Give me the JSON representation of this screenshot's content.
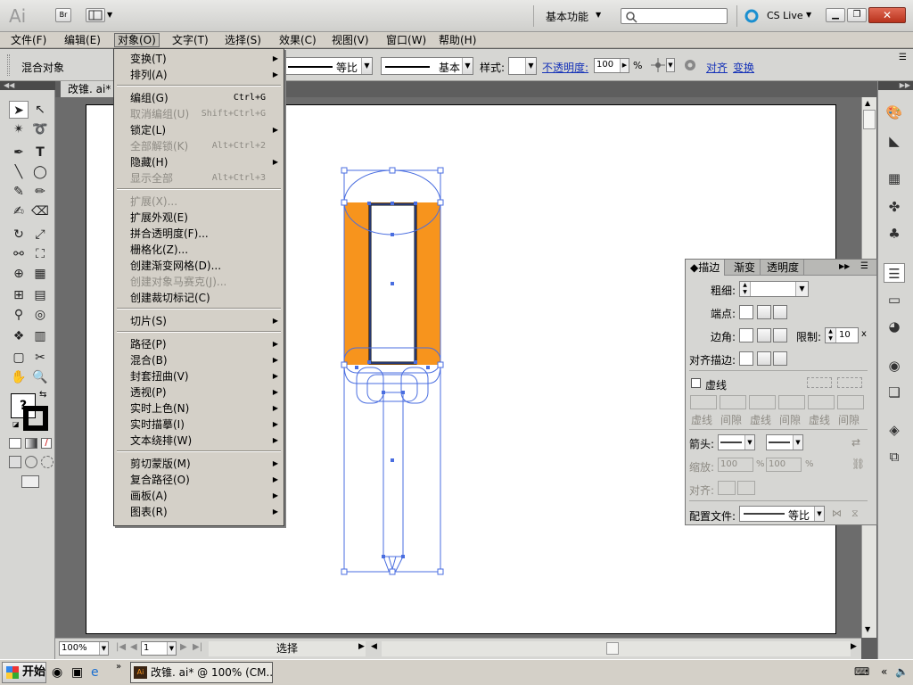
{
  "app": {
    "logo": "Ai",
    "bridge_label": "Br",
    "workspace": "基本功能",
    "search_placeholder": "",
    "cs_live": "CS Live"
  },
  "menubar": [
    {
      "label": "文件(F)"
    },
    {
      "label": "编辑(E)"
    },
    {
      "label": "对象(O)"
    },
    {
      "label": "文字(T)"
    },
    {
      "label": "选择(S)"
    },
    {
      "label": "效果(C)"
    },
    {
      "label": "视图(V)"
    },
    {
      "label": "窗口(W)"
    },
    {
      "label": "帮助(H)"
    }
  ],
  "control_bar": {
    "selection_label": "混合对象",
    "profile_label": "等比",
    "brush_label": "基本",
    "style_label": "样式:",
    "opacity_label": "不透明度:",
    "opacity_value": "100",
    "percent": "%",
    "align_link": "对齐",
    "transform_link": "变换"
  },
  "document_tab": "改锥. ai*",
  "object_menu": {
    "items": [
      {
        "label": "变换(T)",
        "shortcut": "",
        "submenu": true,
        "disabled": false
      },
      {
        "label": "排列(A)",
        "shortcut": "",
        "submenu": true,
        "disabled": false
      },
      {
        "sep": true
      },
      {
        "label": "编组(G)",
        "shortcut": "Ctrl+G",
        "submenu": false,
        "disabled": false
      },
      {
        "label": "取消编组(U)",
        "shortcut": "Shift+Ctrl+G",
        "submenu": false,
        "disabled": true
      },
      {
        "label": "锁定(L)",
        "shortcut": "",
        "submenu": true,
        "disabled": false
      },
      {
        "label": "全部解锁(K)",
        "shortcut": "Alt+Ctrl+2",
        "submenu": false,
        "disabled": true
      },
      {
        "label": "隐藏(H)",
        "shortcut": "",
        "submenu": true,
        "disabled": false
      },
      {
        "label": "显示全部",
        "shortcut": "Alt+Ctrl+3",
        "submenu": false,
        "disabled": true
      },
      {
        "sep": true
      },
      {
        "label": "扩展(X)...",
        "shortcut": "",
        "submenu": false,
        "disabled": true
      },
      {
        "label": "扩展外观(E)",
        "shortcut": "",
        "submenu": false,
        "disabled": false
      },
      {
        "label": "拼合透明度(F)...",
        "shortcut": "",
        "submenu": false,
        "disabled": false
      },
      {
        "label": "栅格化(Z)...",
        "shortcut": "",
        "submenu": false,
        "disabled": false
      },
      {
        "label": "创建渐变网格(D)...",
        "shortcut": "",
        "submenu": false,
        "disabled": false
      },
      {
        "label": "创建对象马赛克(J)...",
        "shortcut": "",
        "submenu": false,
        "disabled": true
      },
      {
        "label": "创建裁切标记(C)",
        "shortcut": "",
        "submenu": false,
        "disabled": false
      },
      {
        "sep": true
      },
      {
        "label": "切片(S)",
        "shortcut": "",
        "submenu": true,
        "disabled": false
      },
      {
        "sep": true
      },
      {
        "label": "路径(P)",
        "shortcut": "",
        "submenu": true,
        "disabled": false
      },
      {
        "label": "混合(B)",
        "shortcut": "",
        "submenu": true,
        "disabled": false
      },
      {
        "label": "封套扭曲(V)",
        "shortcut": "",
        "submenu": true,
        "disabled": false
      },
      {
        "label": "透视(P)",
        "shortcut": "",
        "submenu": true,
        "disabled": false
      },
      {
        "label": "实时上色(N)",
        "shortcut": "",
        "submenu": true,
        "disabled": false
      },
      {
        "label": "实时描摹(I)",
        "shortcut": "",
        "submenu": true,
        "disabled": false
      },
      {
        "label": "文本绕排(W)",
        "shortcut": "",
        "submenu": true,
        "disabled": false
      },
      {
        "sep": true
      },
      {
        "label": "剪切蒙版(M)",
        "shortcut": "",
        "submenu": true,
        "disabled": false
      },
      {
        "label": "复合路径(O)",
        "shortcut": "",
        "submenu": true,
        "disabled": false
      },
      {
        "label": "画板(A)",
        "shortcut": "",
        "submenu": true,
        "disabled": false
      },
      {
        "label": "图表(R)",
        "shortcut": "",
        "submenu": true,
        "disabled": false
      }
    ]
  },
  "stroke_panel": {
    "tabs": [
      "描边",
      "渐变",
      "透明度"
    ],
    "weight_label": "粗细:",
    "cap_label": "端点:",
    "corner_label": "边角:",
    "limit_label": "限制:",
    "limit_value": "10",
    "limit_unit": "x",
    "align_label": "对齐描边:",
    "dashed_label": "虚线",
    "dash_labels": [
      "虚线",
      "间隙",
      "虚线",
      "间隙",
      "虚线",
      "间隙"
    ],
    "arrow_label": "箭头:",
    "scale_label": "缩放:",
    "scale_value_1": "100",
    "scale_value_2": "100",
    "align2_label": "对齐:",
    "profile_label": "配置文件:",
    "profile_value": "等比"
  },
  "status_bar": {
    "zoom": "100%",
    "page": "1",
    "tool": "选择"
  },
  "taskbar": {
    "start": "开始",
    "task_item": "改锥. ai* @ 100% (CM..."
  },
  "colors": {
    "orange_fill": "#f7941d",
    "selection_blue": "#4a6ee0"
  }
}
